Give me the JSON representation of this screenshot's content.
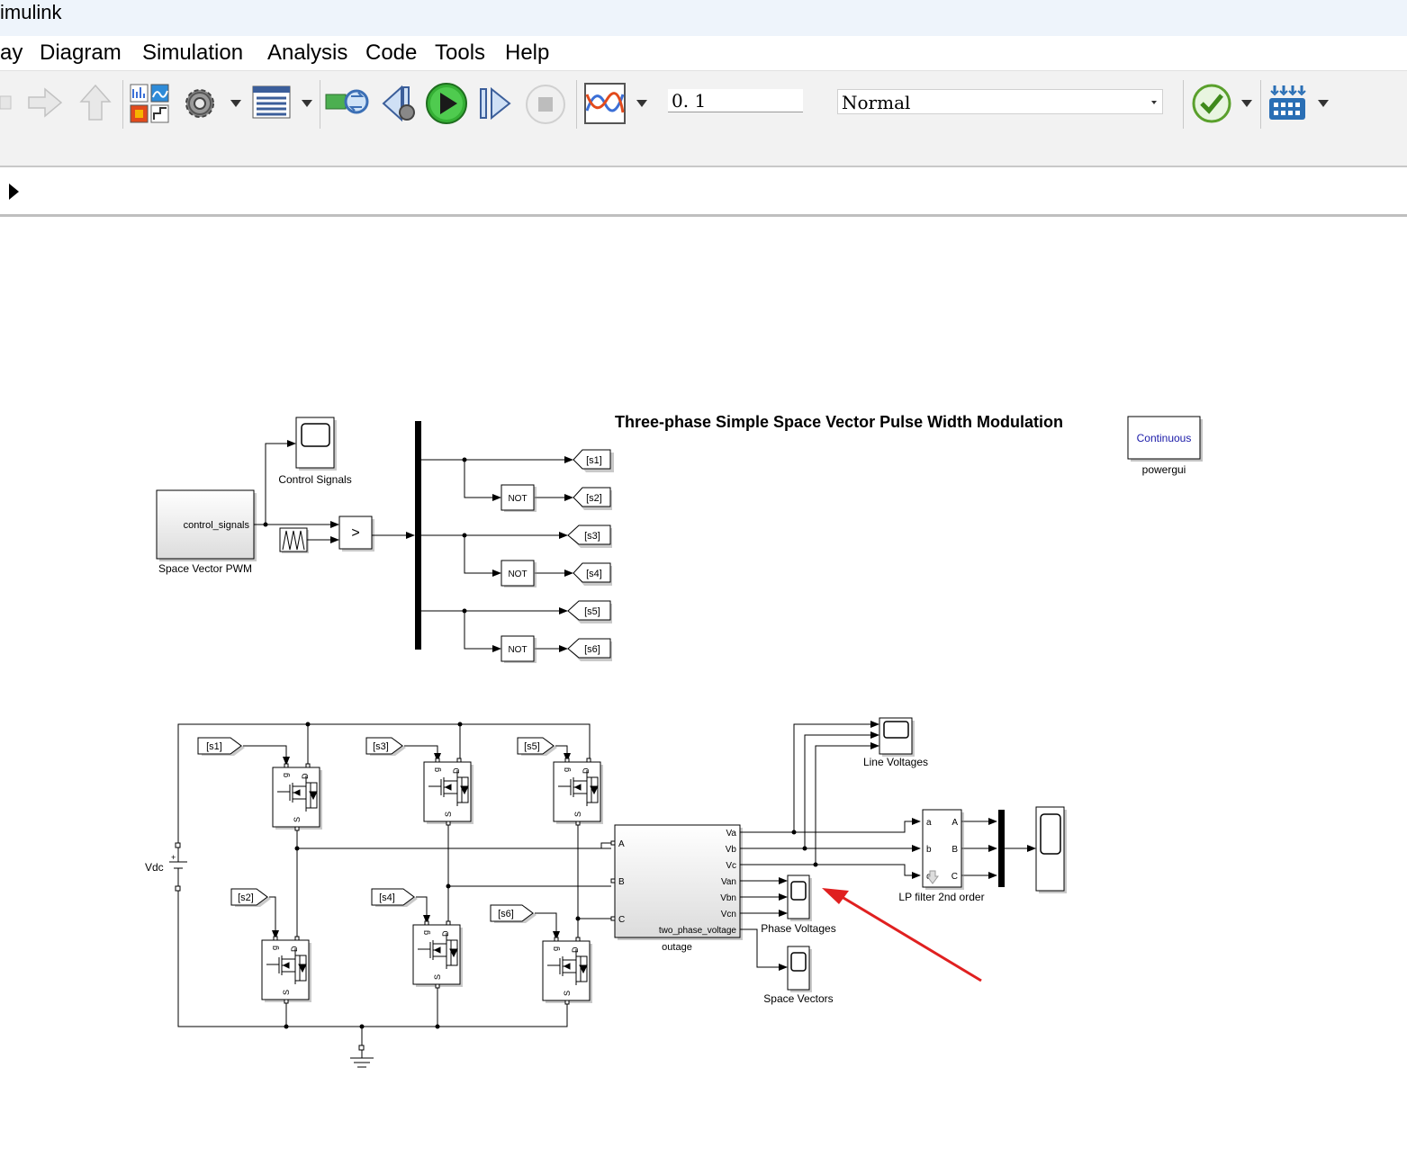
{
  "app": {
    "title": "imulink"
  },
  "menu": [
    "ay",
    "Diagram",
    "Simulation",
    "Analysis",
    "Code",
    "Tools",
    "Help"
  ],
  "toolbar": {
    "stop_time": "0. 1",
    "sim_mode": "Normal",
    "icons": [
      "back-arrow-icon",
      "forward-arrow-icon",
      "up-arrow-icon",
      "library-browser-icon",
      "model-settings-gear-icon",
      "model-explorer-icon",
      "update-diagram-icon",
      "step-back-icon",
      "run-icon",
      "step-forward-icon",
      "stop-icon",
      "data-inspector-icon",
      "model-advisor-check-icon",
      "build-icon"
    ]
  },
  "diagram": {
    "title": "Three-phase Simple Space Vector Pulse Width Modulation",
    "powergui": {
      "mode": "Continuous",
      "label": "powergui"
    },
    "svpwm": {
      "port": "control_signals",
      "label": "Space Vector PWM"
    },
    "control_scope_label": "Control Signals",
    "relational_op": ">",
    "not_label": "NOT",
    "goto_tags": [
      "[s1]",
      "[s2]",
      "[s3]",
      "[s4]",
      "[s5]",
      "[s6]"
    ],
    "from_tags": [
      "[s1]",
      "[s3]",
      "[s5]",
      "[s2]",
      "[s4]",
      "[s6]"
    ],
    "mosfet_ports": {
      "g": "g",
      "d": "D",
      "s": "S"
    },
    "vdc": {
      "label": "Vdc",
      "plus": "+"
    },
    "subsystem": {
      "inputs": [
        "A",
        "B",
        "C"
      ],
      "outputs": [
        "Va",
        "Vb",
        "Vc",
        "Van",
        "Vbn",
        "Vcn",
        "two_phase_voltage"
      ],
      "label": "outage"
    },
    "line_voltages_label": "Line Voltages",
    "phase_voltages_label": "Phase Voltages",
    "space_vectors_label": "Space Vectors",
    "lp_filter": {
      "inputs": [
        "a",
        "b",
        "c"
      ],
      "outputs": [
        "A",
        "B",
        "C"
      ],
      "label": "LP filter 2nd order"
    },
    "annotation_color": "#e02020"
  }
}
